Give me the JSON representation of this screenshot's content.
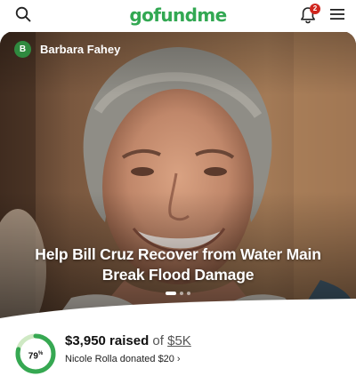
{
  "header": {
    "logo_text": "gofundme",
    "notification_count": "2",
    "brand_color": "#32a852",
    "badge_color": "#d0261e",
    "icons": [
      "search-icon",
      "bell-icon",
      "menu-icon"
    ]
  },
  "hero": {
    "organizer_initial": "B",
    "organizer_name": "Barbara Fahey",
    "title": "Help Bill Cruz Recover from Water Main Break Flood Damage",
    "slides_total": 3,
    "active_slide": 1
  },
  "progress": {
    "percent": 79,
    "percent_label": "79",
    "percent_unit": "%",
    "raised_amount": "$3,950 raised",
    "of_text": "of",
    "goal": "$5K",
    "latest_donation": "Nicole Rolla donated $20",
    "ring_color": "#36a852",
    "ring_track_color": "#cfe9c4"
  }
}
